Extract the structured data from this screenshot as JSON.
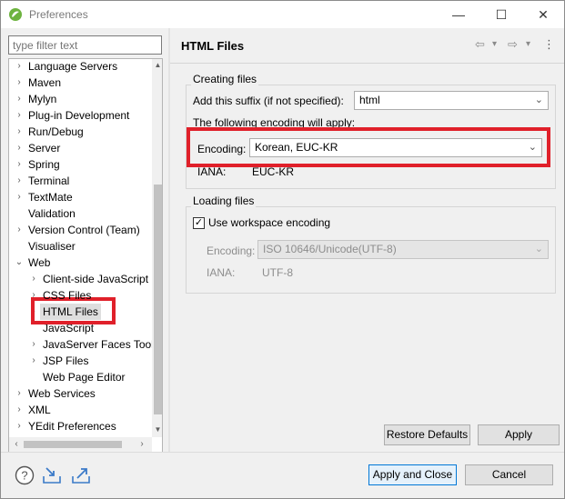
{
  "window": {
    "title": "Preferences",
    "min_glyph": "—",
    "max_glyph": "☐",
    "close_glyph": "✕"
  },
  "left": {
    "filter_placeholder": "type filter text",
    "tree": [
      {
        "label": "Language Servers",
        "arrow": "›"
      },
      {
        "label": "Maven",
        "arrow": "›"
      },
      {
        "label": "Mylyn",
        "arrow": "›"
      },
      {
        "label": "Plug-in Development",
        "arrow": "›"
      },
      {
        "label": "Run/Debug",
        "arrow": "›"
      },
      {
        "label": "Server",
        "arrow": "›"
      },
      {
        "label": "Spring",
        "arrow": "›"
      },
      {
        "label": "Terminal",
        "arrow": "›"
      },
      {
        "label": "TextMate",
        "arrow": "›"
      },
      {
        "label": "Validation",
        "arrow": ""
      },
      {
        "label": "Version Control (Team)",
        "arrow": "›"
      },
      {
        "label": "Visualiser",
        "arrow": ""
      },
      {
        "label": "Web",
        "arrow": "⌄"
      },
      {
        "label": "Client-side JavaScript",
        "arrow": "›"
      },
      {
        "label": "CSS Files",
        "arrow": "›"
      },
      {
        "label": "HTML Files",
        "arrow": "›"
      },
      {
        "label": "JavaScript",
        "arrow": ""
      },
      {
        "label": "JavaServer Faces Tools",
        "arrow": "›"
      },
      {
        "label": "JSP Files",
        "arrow": "›"
      },
      {
        "label": "Web Page Editor",
        "arrow": ""
      },
      {
        "label": "Web Services",
        "arrow": "›"
      },
      {
        "label": "XML",
        "arrow": "›"
      },
      {
        "label": "YEdit Preferences",
        "arrow": "›"
      }
    ]
  },
  "page": {
    "title": "HTML Files",
    "nav": {
      "back": "⇦",
      "back_menu": "▾",
      "forward": "⇨",
      "forward_menu": "▾",
      "more": "⋮"
    },
    "creating": {
      "group_label": "Creating files",
      "suffix_label": "Add this suffix (if not specified):",
      "suffix_value": "html",
      "encoding_note": "The following encoding will apply:",
      "encoding_label": "Encoding:",
      "encoding_value": "Korean, EUC-KR",
      "iana_label": "IANA:",
      "iana_value": "EUC-KR"
    },
    "loading": {
      "group_label": "Loading files",
      "use_workspace_label": "Use workspace encoding",
      "use_workspace_checked": true,
      "encoding_label": "Encoding:",
      "encoding_value": "ISO 10646/Unicode(UTF-8)",
      "iana_label": "IANA:",
      "iana_value": "UTF-8"
    },
    "restore_defaults": "Restore Defaults",
    "apply": "Apply"
  },
  "footer": {
    "help_icon": "help-icon",
    "import_icon": "import-icon",
    "export_icon": "export-icon",
    "apply_and_close": "Apply and Close",
    "cancel": "Cancel"
  },
  "colors": {
    "highlight": "#e0202a",
    "accent": "#0078d7"
  },
  "glyphs": {
    "check": "✓",
    "combo_arrow": "⌄",
    "up": "▲",
    "down": "▼",
    "left": "‹",
    "right": "›"
  }
}
